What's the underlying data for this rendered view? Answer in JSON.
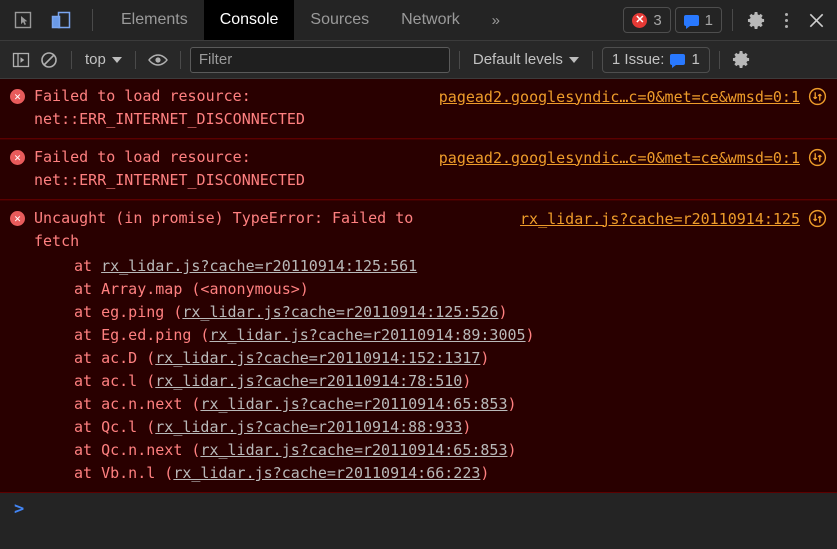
{
  "toolbar": {
    "inspect_icon": "inspect-cursor-icon",
    "device_icon": "device-toolbar-icon",
    "tabs": [
      {
        "label": "Elements",
        "active": false
      },
      {
        "label": "Console",
        "active": true
      },
      {
        "label": "Sources",
        "active": false
      },
      {
        "label": "Network",
        "active": false
      }
    ],
    "more_tabs": "»",
    "error_count": "3",
    "message_count": "1",
    "settings_icon": "gear-icon",
    "menu_icon": "kebab-menu-icon",
    "close_icon": "close-icon"
  },
  "filterbar": {
    "sidebar_toggle_icon": "console-sidebar-icon",
    "clear_icon": "clear-console-icon",
    "context": "top",
    "eye_icon": "live-expression-eye-icon",
    "filter_placeholder": "Filter",
    "filter_value": "",
    "levels": "Default levels",
    "issues_label": "1 Issue:",
    "issues_count": "1",
    "settings_icon": "console-settings-gear-icon"
  },
  "messages": [
    {
      "level": "error",
      "text": "Failed to load resource: net::ERR_INTERNET_DISCONNECTED",
      "link": "pagead2.googlesyndic…c=0&met=ce&wmsd=0:1",
      "stack": []
    },
    {
      "level": "error",
      "text": "Failed to load resource: net::ERR_INTERNET_DISCONNECTED",
      "link": "pagead2.googlesyndic…c=0&met=ce&wmsd=0:1",
      "stack": []
    },
    {
      "level": "error",
      "text": "Uncaught (in promise) TypeError: Failed to fetch",
      "link": "rx_lidar.js?cache=r20110914:125",
      "stack": [
        {
          "fn": "at ",
          "loc": "rx_lidar.js?cache=r20110914:125:561",
          "tail": "",
          "bare": true
        },
        {
          "fn": "at Array.map (<anonymous>)",
          "loc": "",
          "tail": "",
          "bare": false
        },
        {
          "fn": "at eg.ping (",
          "loc": "rx_lidar.js?cache=r20110914:125:526",
          "tail": ")",
          "bare": false
        },
        {
          "fn": "at Eg.ed.ping (",
          "loc": "rx_lidar.js?cache=r20110914:89:3005",
          "tail": ")",
          "bare": false
        },
        {
          "fn": "at ac.D (",
          "loc": "rx_lidar.js?cache=r20110914:152:1317",
          "tail": ")",
          "bare": false
        },
        {
          "fn": "at ac.l (",
          "loc": "rx_lidar.js?cache=r20110914:78:510",
          "tail": ")",
          "bare": false
        },
        {
          "fn": "at ac.n.next (",
          "loc": "rx_lidar.js?cache=r20110914:65:853",
          "tail": ")",
          "bare": false
        },
        {
          "fn": "at Qc.l (",
          "loc": "rx_lidar.js?cache=r20110914:88:933",
          "tail": ")",
          "bare": false
        },
        {
          "fn": "at Qc.n.next (",
          "loc": "rx_lidar.js?cache=r20110914:65:853",
          "tail": ")",
          "bare": false
        },
        {
          "fn": "at Vb.n.l (",
          "loc": "rx_lidar.js?cache=r20110914:66:223",
          "tail": ")",
          "bare": false
        }
      ]
    }
  ],
  "prompt": {
    "caret": ">",
    "value": ""
  },
  "colors": {
    "error_bg": "#290000",
    "error_text": "#ff8080",
    "link": "#ee9c2a",
    "accent_blue": "#4285f4",
    "active_tab_bg": "#000000"
  }
}
